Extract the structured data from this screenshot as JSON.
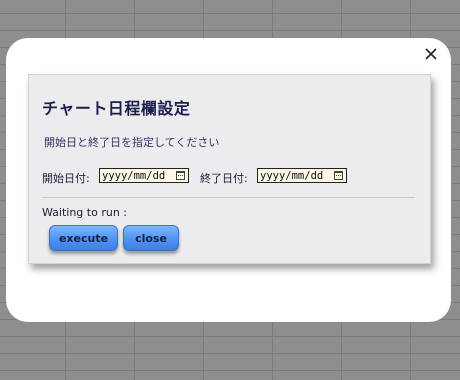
{
  "dialog": {
    "close_icon": "close-icon"
  },
  "panel": {
    "title": "チャート日程欄設定",
    "subtitle": "開始日と終了日を指定してください",
    "start_label": "開始日付:",
    "start_placeholder": "yyyy/mm/dd",
    "end_label": "終了日付:",
    "end_placeholder": "yyyy/mm/dd",
    "status": "Waiting to run :",
    "execute_label": "execute",
    "close_label": "close"
  },
  "colors": {
    "title": "#1c1f4d",
    "button": "#4f93f3",
    "date_field_bg": "#fbf8e6"
  }
}
